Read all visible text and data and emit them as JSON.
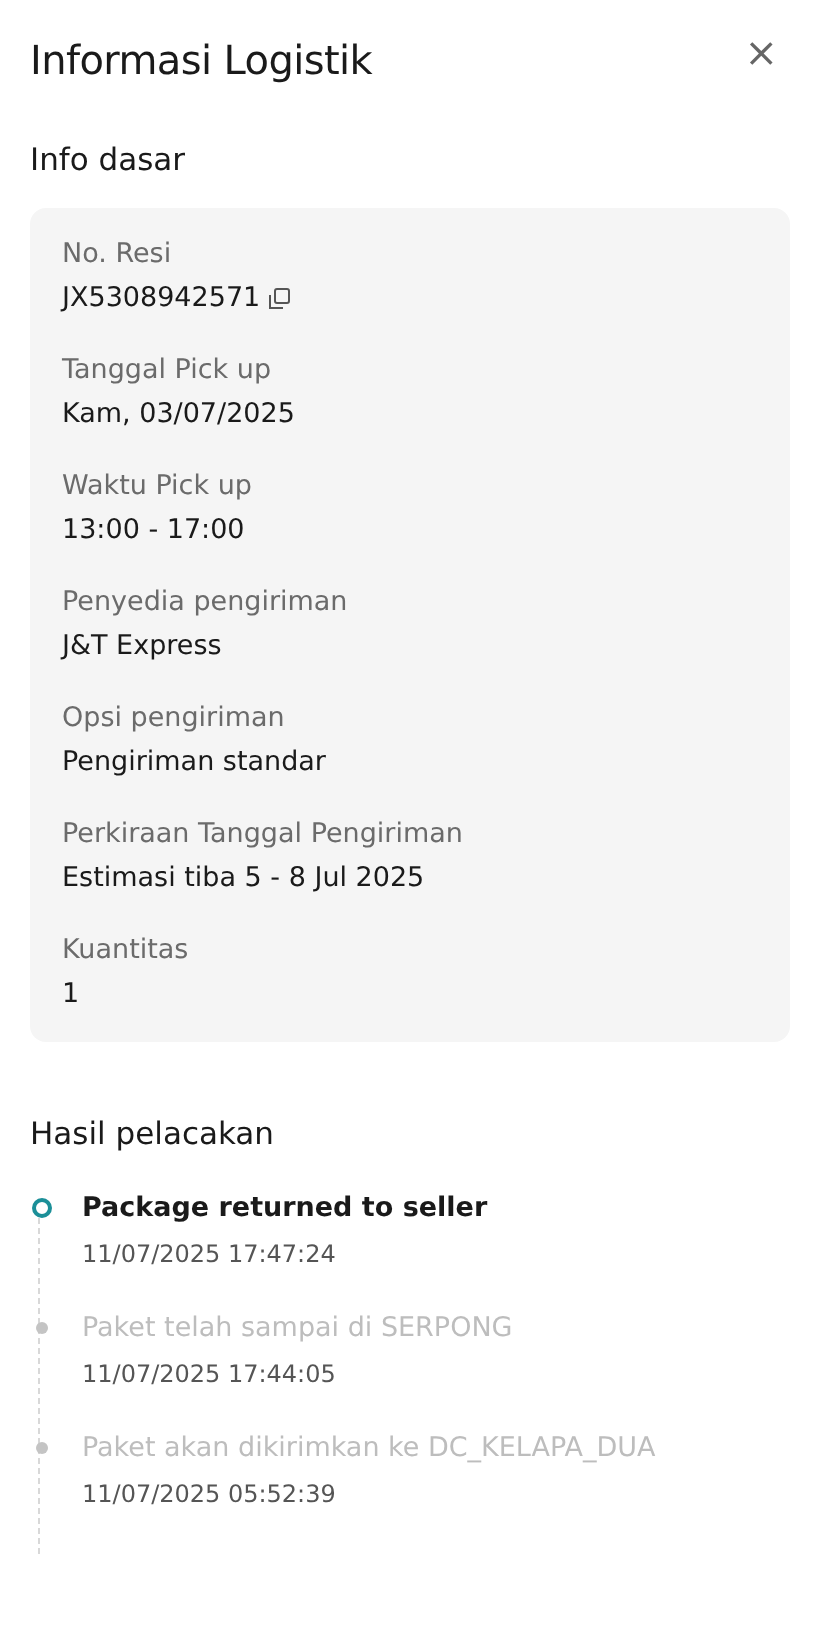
{
  "title": "Informasi Logistik",
  "close": "×",
  "basic_info": {
    "heading": "Info dasar",
    "fields": [
      {
        "label": "No. Resi",
        "value": "JX5308942571",
        "copyable": true
      },
      {
        "label": "Tanggal Pick up",
        "value": "Kam, 03/07/2025",
        "copyable": false
      },
      {
        "label": "Waktu Pick up",
        "value": "13:00 - 17:00",
        "copyable": false
      },
      {
        "label": "Penyedia pengiriman",
        "value": "J&T Express",
        "copyable": false
      },
      {
        "label": "Opsi pengiriman",
        "value": "Pengiriman standar",
        "copyable": false
      },
      {
        "label": "Perkiraan Tanggal Pengiriman",
        "value": "Estimasi tiba 5 - 8 Jul 2025",
        "copyable": false
      },
      {
        "label": "Kuantitas",
        "value": "1",
        "copyable": false
      }
    ]
  },
  "tracking": {
    "heading": "Hasil pelacakan",
    "events": [
      {
        "status": "Package returned to seller",
        "time": "11/07/2025 17:47:24",
        "current": true
      },
      {
        "status": "Paket telah sampai di SERPONG",
        "time": "11/07/2025 17:44:05",
        "current": false
      },
      {
        "status": "Paket akan dikirimkan ke DC_KELAPA_DUA",
        "time": "11/07/2025 05:52:39",
        "current": false
      }
    ]
  }
}
